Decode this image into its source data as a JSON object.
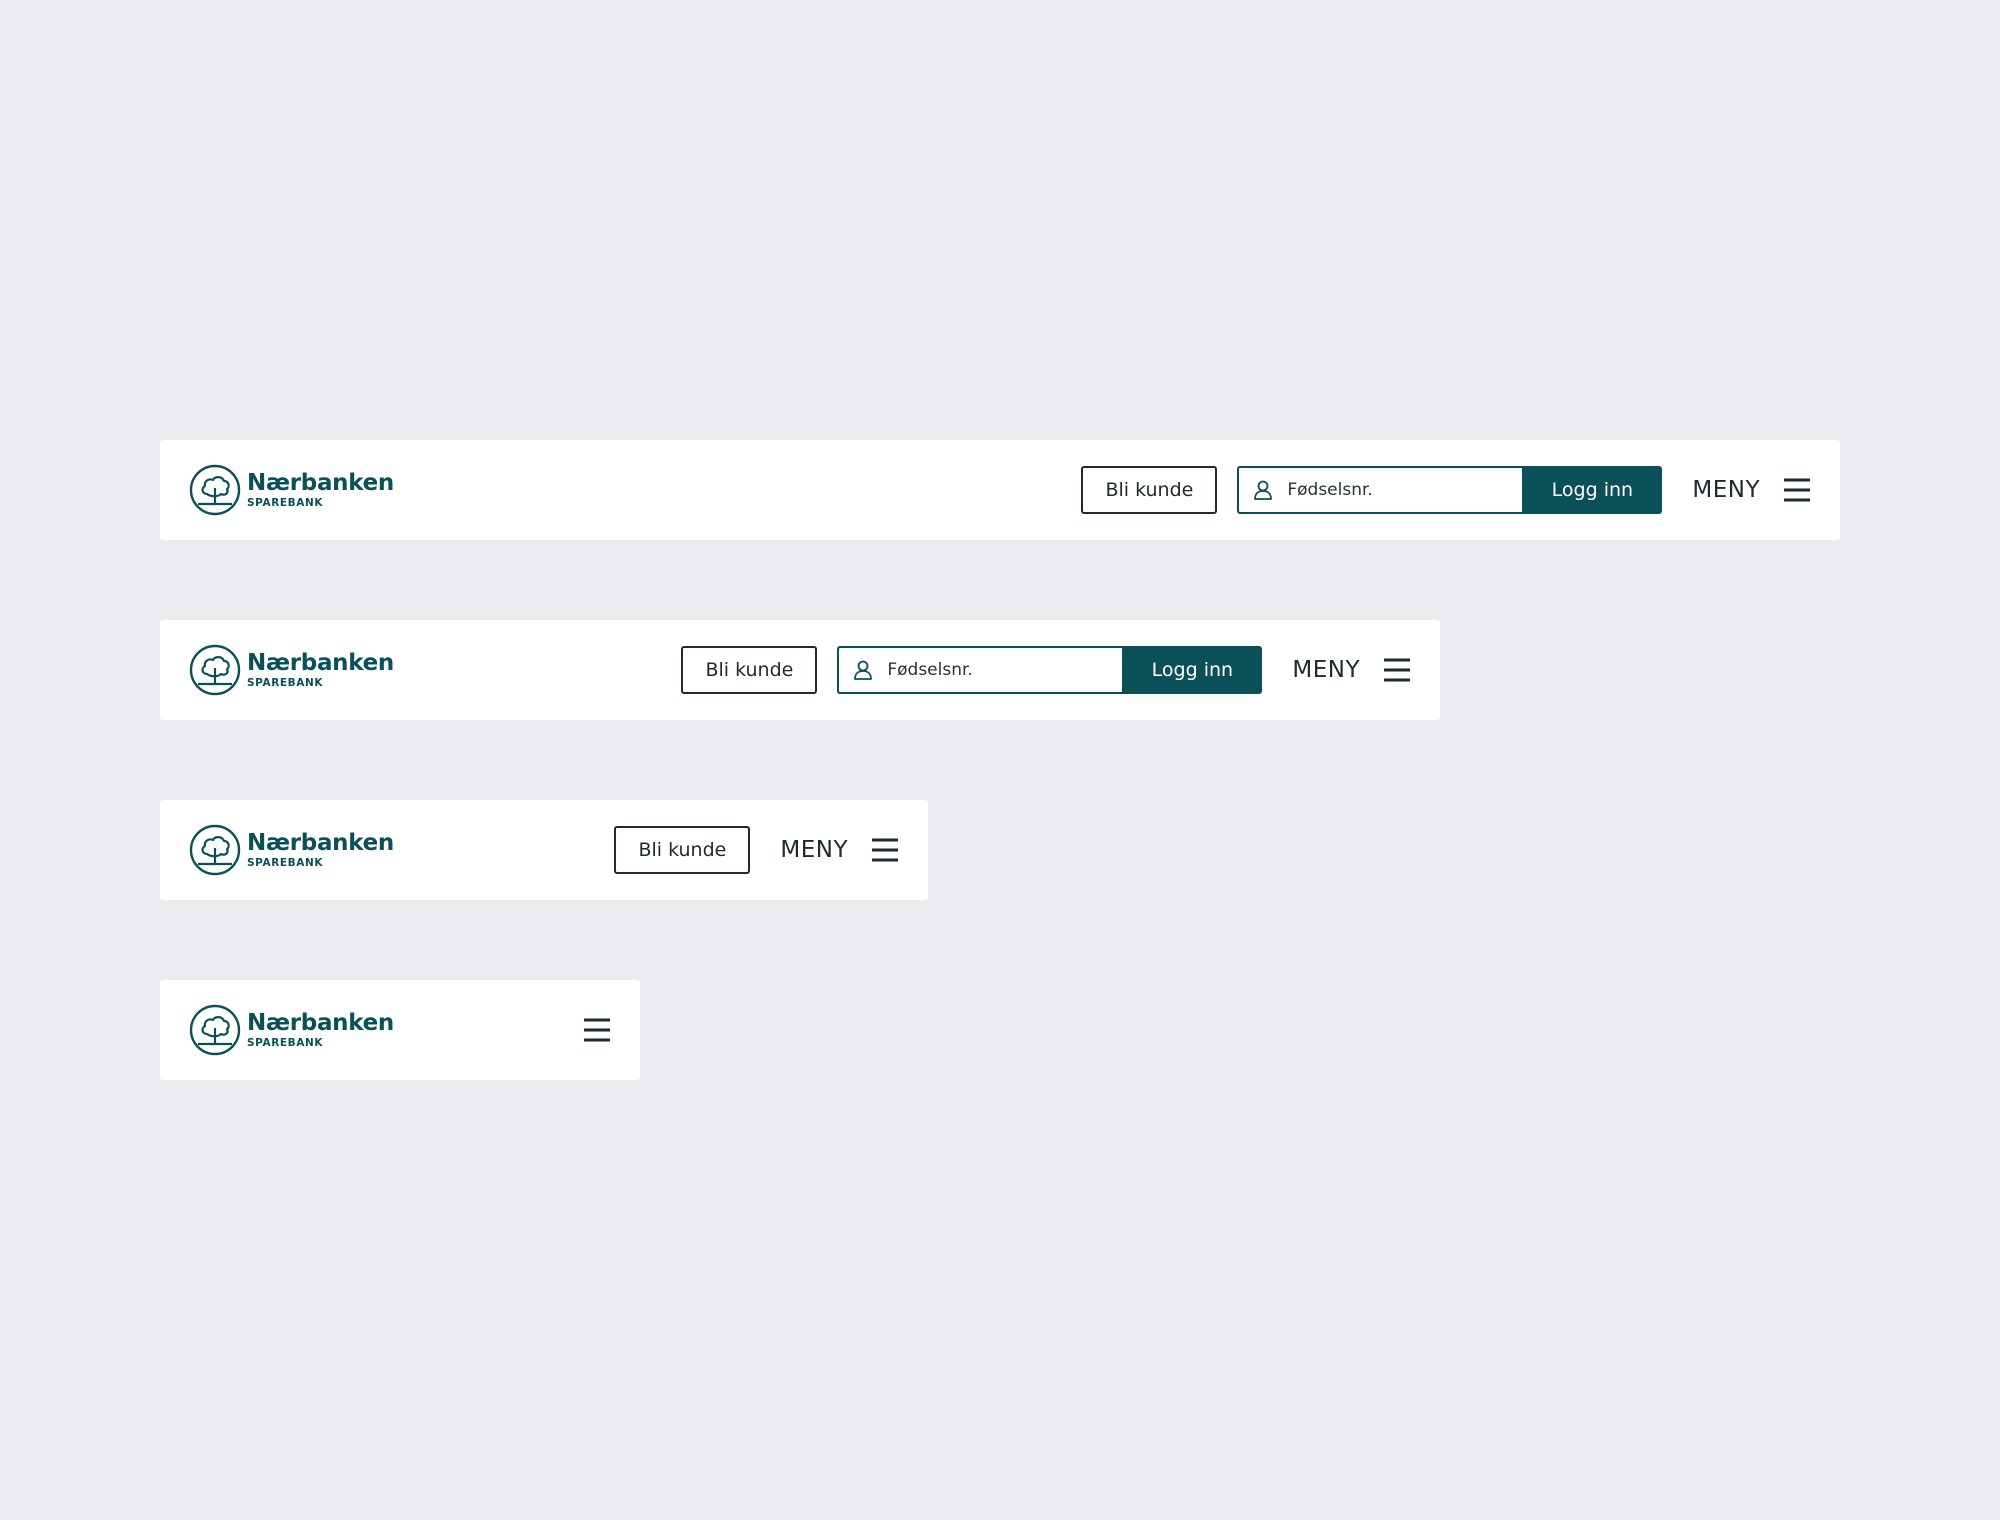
{
  "brand": {
    "name": "Nærbanken",
    "subtitle": "SPAREBANK",
    "color": "#0B5058"
  },
  "actions": {
    "become_customer_label": "Bli kunde",
    "ssn_placeholder": "Fødselsnr.",
    "login_label": "Logg inn",
    "menu_label": "MENY"
  },
  "icons": {
    "logo": "tree-in-circle-icon",
    "user": "user-icon",
    "menu": "hamburger-menu-icon"
  },
  "colors": {
    "background": "#EBECEF",
    "surface": "#FFFFFF",
    "primary": "#0B5058",
    "text": "#1F2A2E"
  }
}
